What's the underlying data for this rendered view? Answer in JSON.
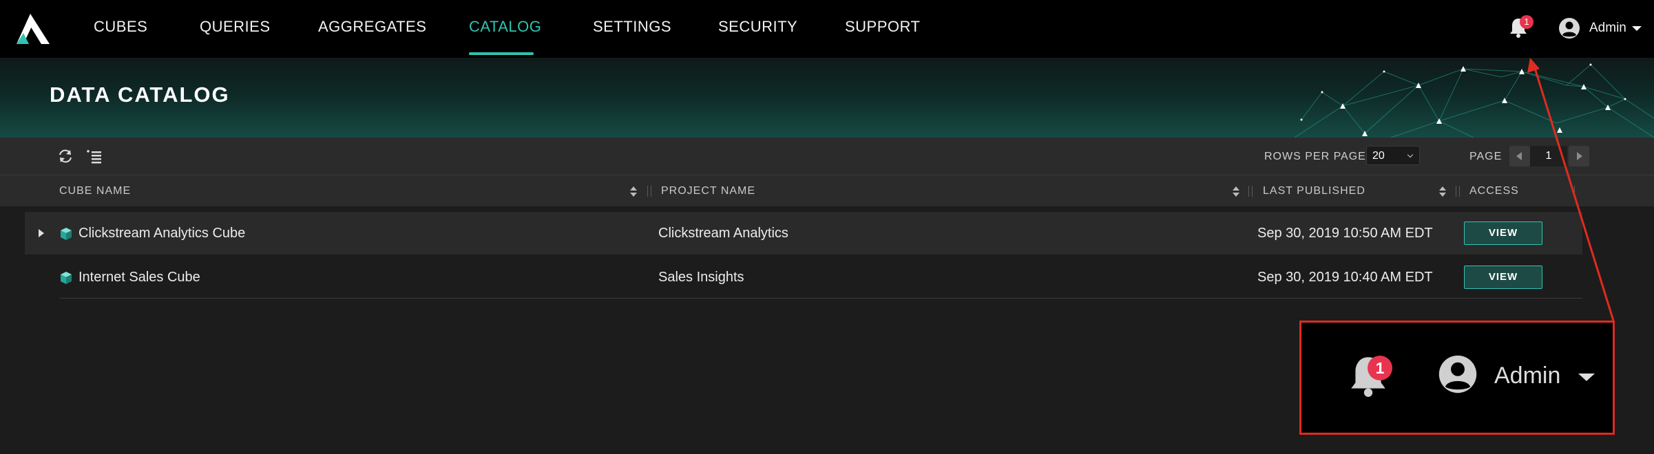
{
  "nav": {
    "items": [
      {
        "label": "CUBES",
        "active": false
      },
      {
        "label": "QUERIES",
        "active": false
      },
      {
        "label": "AGGREGATES",
        "active": false
      },
      {
        "label": "CATALOG",
        "active": true
      },
      {
        "label": "SETTINGS",
        "active": false
      },
      {
        "label": "SECURITY",
        "active": false
      },
      {
        "label": "SUPPORT",
        "active": false
      }
    ],
    "notification_count": "1",
    "user_label": "Admin",
    "accent_color": "#2fc4b2"
  },
  "banner": {
    "title": "DATA CATALOG"
  },
  "toolbar": {
    "icons": [
      "refresh-icon",
      "add-list-icon"
    ],
    "rows_per_page_label": "ROWS PER PAGE",
    "rows_per_page_value": "20",
    "page_label": "PAGE",
    "page_value": "1"
  },
  "table": {
    "columns": [
      "CUBE NAME",
      "PROJECT NAME",
      "LAST PUBLISHED",
      "ACCESS"
    ],
    "rows": [
      {
        "cube_name": "Clickstream Analytics Cube",
        "project_name": "Clickstream Analytics",
        "last_published": "Sep 30, 2019 10:50 AM EDT",
        "access": "VIEW",
        "expandable": true
      },
      {
        "cube_name": "Internet Sales Cube",
        "project_name": "Sales Insights",
        "last_published": "Sep 30, 2019 10:40 AM EDT",
        "access": "VIEW",
        "expandable": false
      }
    ]
  },
  "callout": {
    "notification_count": "1",
    "user_label": "Admin",
    "border_color": "#e02b20"
  }
}
